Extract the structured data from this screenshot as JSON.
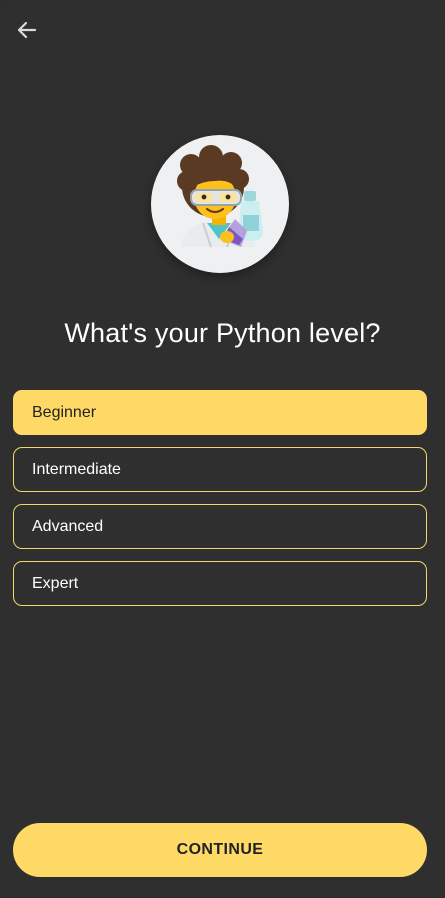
{
  "header": {
    "back_icon": "arrow-left-icon"
  },
  "illustration": {
    "icon": "scientist-emoji-icon"
  },
  "question": {
    "title": "What's your Python level?"
  },
  "options": [
    {
      "label": "Beginner",
      "selected": true
    },
    {
      "label": "Intermediate",
      "selected": false
    },
    {
      "label": "Advanced",
      "selected": false
    },
    {
      "label": "Expert",
      "selected": false
    }
  ],
  "footer": {
    "continue_label": "CONTINUE"
  },
  "colors": {
    "background": "#2f2f2f",
    "accent": "#ffd966",
    "option_border": "#f5d66a",
    "text": "#ffffff",
    "button_text": "#222222"
  }
}
